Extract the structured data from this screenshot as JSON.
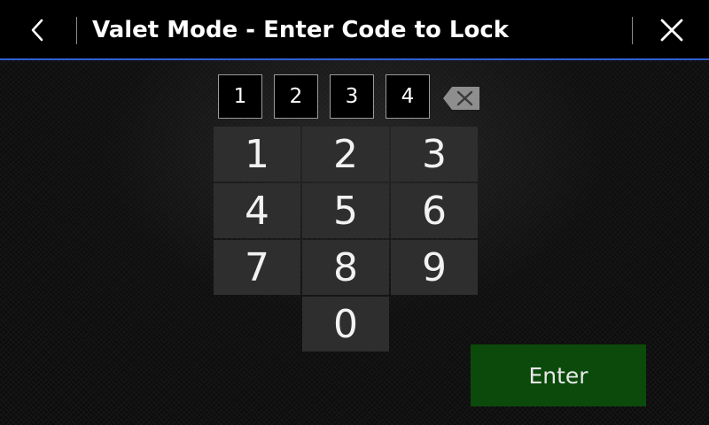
{
  "header": {
    "title": "Valet Mode - Enter Code to Lock",
    "back_icon": "chevron-left-icon",
    "close_icon": "close-icon",
    "accent_color": "#2f5fd6"
  },
  "code_entry": {
    "digits": [
      "1",
      "2",
      "3",
      "4"
    ],
    "backspace_icon": "backspace-icon"
  },
  "keypad": {
    "keys": [
      "1",
      "2",
      "3",
      "4",
      "5",
      "6",
      "7",
      "8",
      "9",
      "0"
    ]
  },
  "enter_button": {
    "label": "Enter",
    "color": "#0b4a0b"
  }
}
